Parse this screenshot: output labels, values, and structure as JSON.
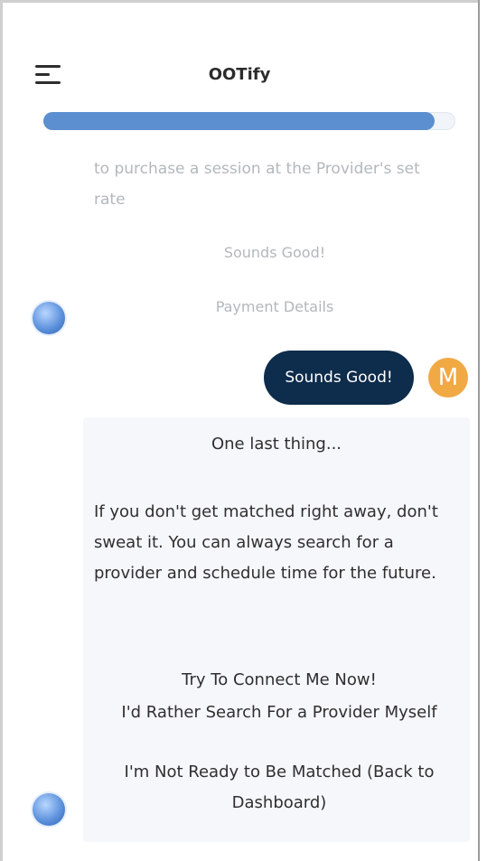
{
  "header": {
    "title": "OOTify",
    "menu_icon": "hamburger-menu-icon"
  },
  "progress": {
    "fraction": 0.95
  },
  "chat": {
    "previous_bot_message": "to purchase a session at the Provider's set rate",
    "previous_option_1": "Sounds Good!",
    "previous_option_2": "Payment Details",
    "user_reply": "Sounds Good!",
    "user_initial": "M",
    "card": {
      "title": "One last thing...",
      "body": "If you don't get matched right away, don't sweat it. You can always search for a provider and schedule time for the future.",
      "options": [
        "Try To Connect Me Now!",
        "I'd Rather Search For a Provider Myself",
        "I'm Not Ready to Be Matched (Back to Dashboard)"
      ]
    }
  },
  "colors": {
    "accent": "#5c8fd0",
    "user_bubble": "#0e2c4b",
    "user_avatar": "#f1a944"
  }
}
